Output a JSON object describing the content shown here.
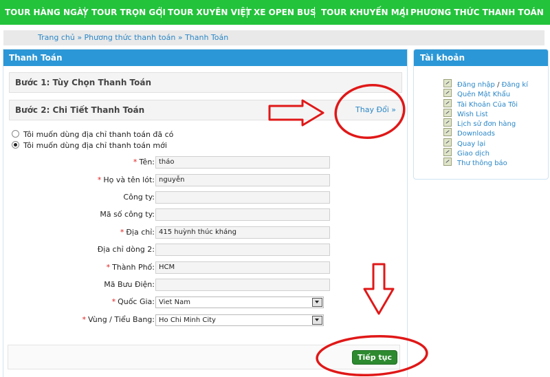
{
  "nav": {
    "items": [
      "TOUR HÀNG NGÀY",
      "TOUR TRỌN GÓI",
      "TOUR XUYÊN VIỆT",
      "XE OPEN BUS",
      "TOUR KHUYẾN MẠI",
      "PHƯƠNG THỨC THANH TOÁN"
    ]
  },
  "breadcrumb": {
    "items": [
      "Trang chủ",
      "Phương thức thanh toán",
      "Thanh Toán"
    ],
    "separator": "»"
  },
  "main": {
    "title": "Thanh Toán",
    "step1": "Bước 1: Tùy Chọn Thanh Toán",
    "step2": "Bước 2: Chi Tiết Thanh Toán",
    "edit_link": "Thay Đổi »",
    "radio_existing": "Tôi muốn dùng địa chỉ thanh toán đã có",
    "radio_new": "Tôi muốn dùng địa chỉ thanh toán mới",
    "fields": {
      "first_name": {
        "label": "Tên:",
        "value": "tháo",
        "required": "*"
      },
      "last_name": {
        "label": "Họ và tên lót:",
        "value": "nguyễn",
        "required": "*"
      },
      "company": {
        "label": "Công ty:",
        "value": ""
      },
      "company_id": {
        "label": "Mã số công ty:",
        "value": ""
      },
      "address1": {
        "label": "Địa chỉ:",
        "value": "415 huỳnh thúc kháng",
        "required": "*"
      },
      "address2": {
        "label": "Địa chỉ dòng 2:",
        "value": ""
      },
      "city": {
        "label": "Thành Phố:",
        "value": "HCM",
        "required": "*"
      },
      "postcode": {
        "label": "Mã Bưu Điện:",
        "value": ""
      },
      "country": {
        "label": "Quốc Gia:",
        "value": "Viet Nam",
        "required": "*"
      },
      "region": {
        "label": "Vùng / Tiểu Bang:",
        "value": "Ho Chi Minh City",
        "required": "*"
      }
    },
    "continue_label": "Tiếp tục"
  },
  "account": {
    "title": "Tài khoản",
    "login": "Đăng nhập",
    "slash": "/",
    "register": "Đăng kí",
    "items": [
      "Quên Mật Khẩu",
      "Tài Khoản Của Tôi",
      "Wish List",
      "Lịch sử đơn hàng",
      "Downloads",
      "Quay lại",
      "Giao dịch",
      "Thư thông báo"
    ]
  },
  "colors": {
    "nav_green": "#23c33b",
    "header_blue": "#2b97d6",
    "link_blue": "#2a87c7",
    "button_green": "#2d8a2f",
    "annotation_red": "#e01818"
  }
}
